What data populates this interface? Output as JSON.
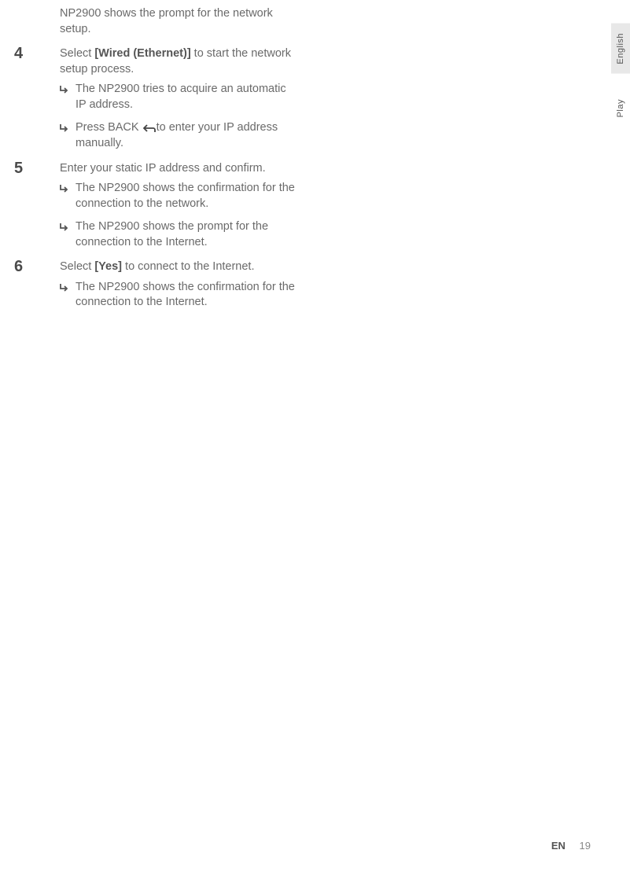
{
  "continuation": "NP2900 shows the prompt for the network setup.",
  "steps": [
    {
      "number": "4",
      "pre": "Select ",
      "bold": "[Wired (Ethernet)]",
      "post": " to start the network setup process.",
      "subs": [
        {
          "text": "The NP2900 tries to acquire an automatic IP address."
        },
        {
          "pre": "Press ",
          "bold": "BACK",
          "back_icon": true,
          "post": "to enter your IP address manually."
        }
      ]
    },
    {
      "number": "5",
      "pre": "Enter your static IP address and confirm.",
      "bold": "",
      "post": "",
      "subs": [
        {
          "text": "The NP2900 shows the confirmation for the connection to the network."
        },
        {
          "text": "The NP2900 shows the prompt for the connection to the Internet."
        }
      ]
    },
    {
      "number": "6",
      "pre": "Select ",
      "bold": "[Yes]",
      "post": " to connect to the Internet.",
      "subs": [
        {
          "text": "The NP2900 shows the confirmation for the connection to the Internet."
        }
      ]
    }
  ],
  "tabs": {
    "english": "English",
    "play": "Play"
  },
  "footer": {
    "lang": "EN",
    "page": "19"
  }
}
